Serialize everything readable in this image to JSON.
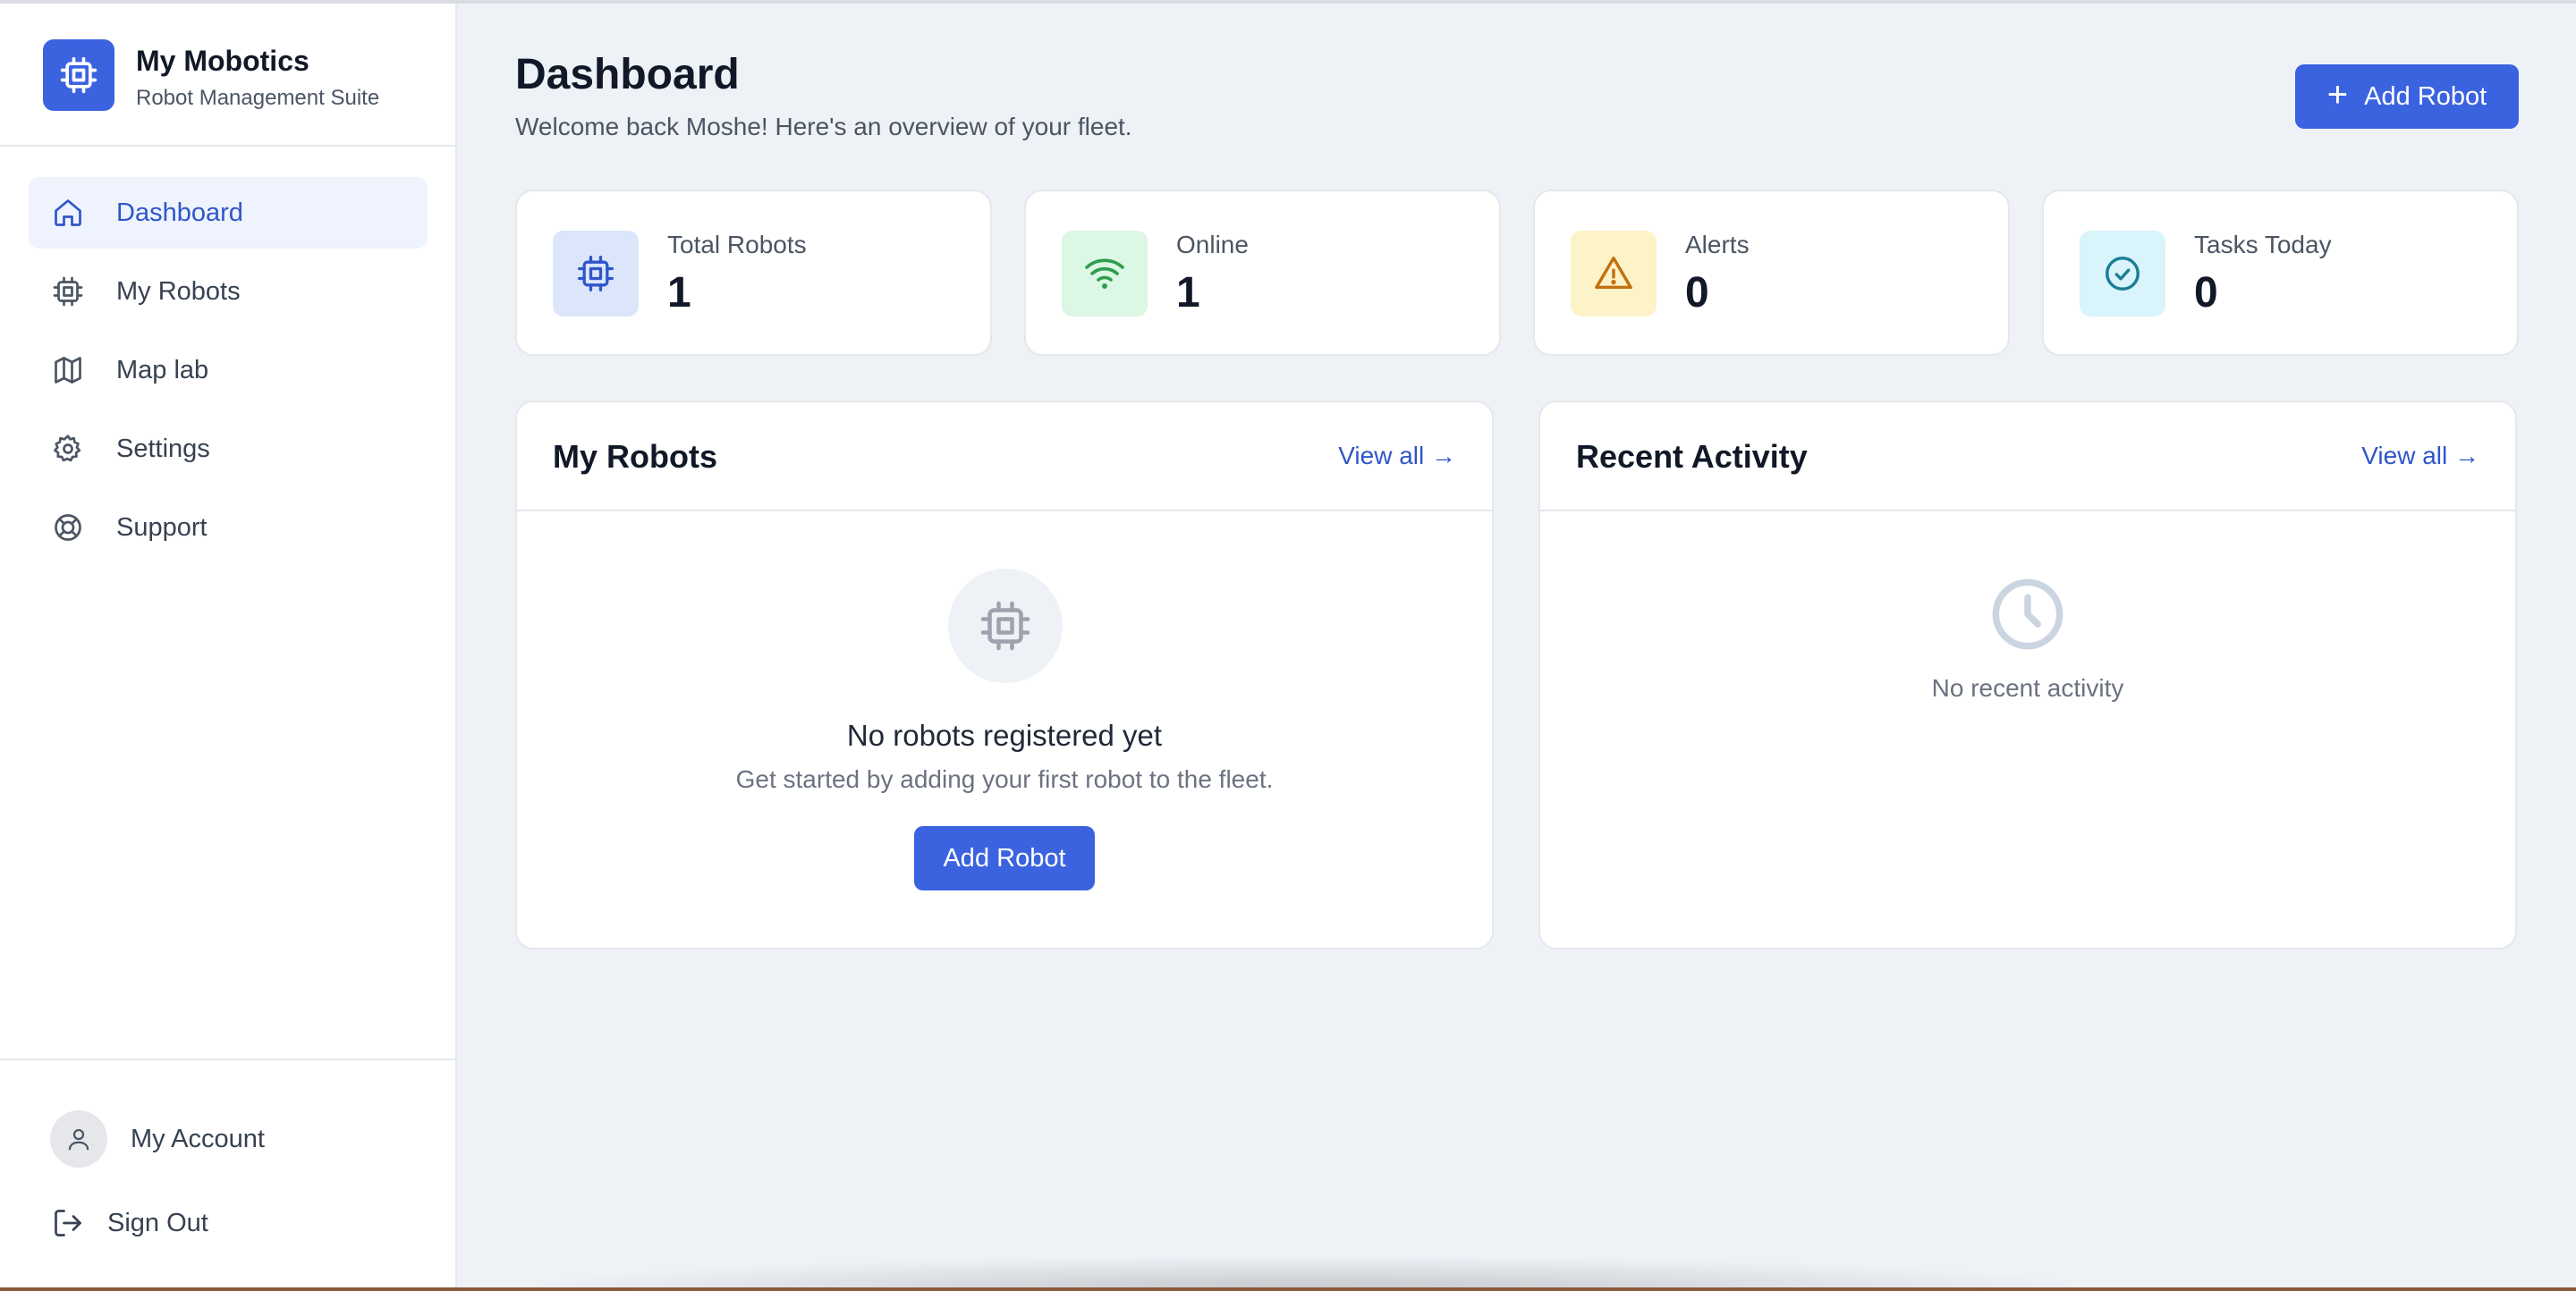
{
  "brand": {
    "title": "My Mobotics",
    "subtitle": "Robot Management Suite",
    "logo_icon": "cpu-icon",
    "accent_color": "#3b63e0"
  },
  "nav": [
    {
      "label": "Dashboard",
      "icon": "home-icon",
      "active": true
    },
    {
      "label": "My Robots",
      "icon": "cpu-icon",
      "active": false
    },
    {
      "label": "Map lab",
      "icon": "map-icon",
      "active": false
    },
    {
      "label": "Settings",
      "icon": "gear-icon",
      "active": false
    },
    {
      "label": "Support",
      "icon": "lifebuoy-icon",
      "active": false
    }
  ],
  "account": {
    "label": "My Account",
    "icon": "user-icon"
  },
  "signout": {
    "label": "Sign Out",
    "icon": "logout-icon"
  },
  "header": {
    "title": "Dashboard",
    "subtitle": "Welcome back Moshe! Here's an overview of your fleet.",
    "add_button": "Add Robot"
  },
  "stats": [
    {
      "label": "Total Robots",
      "value": "1",
      "icon": "cpu-icon",
      "color": "#dbe6fb"
    },
    {
      "label": "Online",
      "value": "1",
      "icon": "wifi-icon",
      "color": "#dcf7e3"
    },
    {
      "label": "Alerts",
      "value": "0",
      "icon": "warning-icon",
      "color": "#fdf3c9"
    },
    {
      "label": "Tasks Today",
      "value": "0",
      "icon": "check-circle-icon",
      "color": "#d9f5fb"
    }
  ],
  "robots_panel": {
    "title": "My Robots",
    "view_all": "View all →",
    "empty_title": "No robots registered yet",
    "empty_subtitle": "Get started by adding your first robot to the fleet.",
    "add_button": "Add Robot"
  },
  "activity_panel": {
    "title": "Recent Activity",
    "view_all": "View all →",
    "empty_text": "No recent activity"
  }
}
